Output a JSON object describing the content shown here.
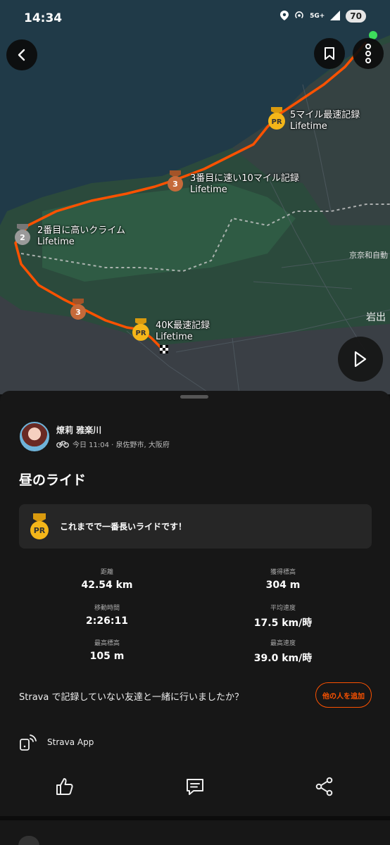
{
  "status_bar": {
    "time": "14:34",
    "network": "5G+",
    "battery": "70"
  },
  "map": {
    "labels": [
      {
        "title": "5マイル最速記録",
        "sub": "Lifetime",
        "badge": "PR"
      },
      {
        "title": "3番目に速い10マイル記録",
        "sub": "Lifetime",
        "badge": "3"
      },
      {
        "title": "2番目に高いクライム",
        "sub": "Lifetime",
        "badge": "2"
      },
      {
        "title": "40K最速記録",
        "sub": "Lifetime",
        "badge": "PR"
      }
    ],
    "extra_badge": "3",
    "place_labels": [
      "京奈和自動",
      "岩出"
    ],
    "route_color": "#fc5200"
  },
  "athlete": {
    "name": "燎莉 雅楽川",
    "meta": "今日 11:04 · 泉佐野市, 大阪府"
  },
  "activity": {
    "title": "昼のライド"
  },
  "achievement": {
    "badge": "PR",
    "text": "これまでで一番長いライドです！"
  },
  "stats": [
    {
      "label": "距離",
      "value": "42.54 km"
    },
    {
      "label": "獲得標高",
      "value": "304 m"
    },
    {
      "label": "移動時間",
      "value": "2:26:11"
    },
    {
      "label": "平均速度",
      "value": "17.5 km/時"
    },
    {
      "label": "最高標高",
      "value": "105 m"
    },
    {
      "label": "最高速度",
      "value": "39.0 km/時"
    }
  ],
  "friends": {
    "question": "Strava で記録していない友達と一緒に行いましたか？",
    "button": "他の人を追加"
  },
  "device": {
    "label": "Strava App"
  },
  "colors": {
    "accent": "#fc5200",
    "sheet": "#171717",
    "card": "#262626",
    "pr_gold": "#f4b619",
    "bronze": "#c56a3a",
    "silver": "#9a9a9a"
  }
}
